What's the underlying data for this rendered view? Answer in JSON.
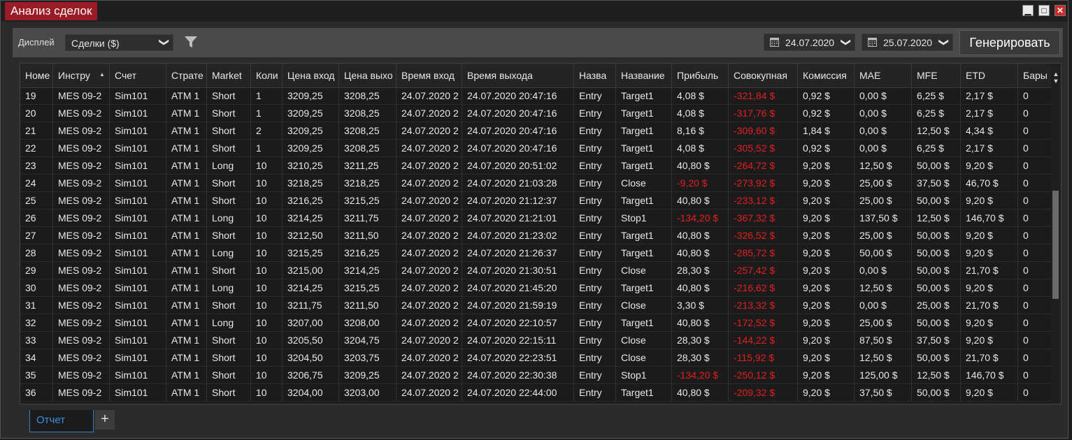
{
  "window": {
    "title": "Анализ сделок",
    "min_glyph": "▁",
    "max_glyph": "□",
    "close_glyph": "✕"
  },
  "toolbar": {
    "display_label": "Дисплей",
    "display_value": "Сделки ($)",
    "from_date": "24.07.2020",
    "to_date": "25.07.2020",
    "generate_label": "Генерировать",
    "chevron": "❯"
  },
  "colors": {
    "negative": "#e02020",
    "accent": "#9b1b26",
    "tab_active": "#3b8fe0"
  },
  "table": {
    "columns": [
      "Номе",
      "Инстру",
      "Счет",
      "Страте",
      "Market",
      "Коли",
      "Цена вход",
      "Цена выхо",
      "Время вход",
      "Время выхода",
      "Назва",
      "Название",
      "Прибыль",
      "Совокупная",
      "Комиссия",
      "MAE",
      "MFE",
      "ETD",
      "Бары"
    ],
    "sort_glyph": "▲",
    "rows": [
      [
        "19",
        "MES 09-2",
        "Sim101",
        "ATM 1",
        "Short",
        "1",
        "3209,25",
        "3208,25",
        "24.07.2020 2",
        "24.07.2020 20:47:16",
        "Entry",
        "Target1",
        "4,08 $",
        "-321,84 $",
        "0,92 $",
        "0,00 $",
        "6,25 $",
        "2,17 $",
        "0"
      ],
      [
        "20",
        "MES 09-2",
        "Sim101",
        "ATM 1",
        "Short",
        "1",
        "3209,25",
        "3208,25",
        "24.07.2020 2",
        "24.07.2020 20:47:16",
        "Entry",
        "Target1",
        "4,08 $",
        "-317,76 $",
        "0,92 $",
        "0,00 $",
        "6,25 $",
        "2,17 $",
        "0"
      ],
      [
        "21",
        "MES 09-2",
        "Sim101",
        "ATM 1",
        "Short",
        "2",
        "3209,25",
        "3208,25",
        "24.07.2020 2",
        "24.07.2020 20:47:16",
        "Entry",
        "Target1",
        "8,16 $",
        "-309,60 $",
        "1,84 $",
        "0,00 $",
        "12,50 $",
        "4,34 $",
        "0"
      ],
      [
        "22",
        "MES 09-2",
        "Sim101",
        "ATM 1",
        "Short",
        "1",
        "3209,25",
        "3208,25",
        "24.07.2020 2",
        "24.07.2020 20:47:16",
        "Entry",
        "Target1",
        "4,08 $",
        "-305,52 $",
        "0,92 $",
        "0,00 $",
        "6,25 $",
        "2,17 $",
        "0"
      ],
      [
        "23",
        "MES 09-2",
        "Sim101",
        "ATM 1",
        "Long",
        "10",
        "3210,25",
        "3211,25",
        "24.07.2020 2",
        "24.07.2020 20:51:02",
        "Entry",
        "Target1",
        "40,80 $",
        "-264,72 $",
        "9,20 $",
        "12,50 $",
        "50,00 $",
        "9,20 $",
        "0"
      ],
      [
        "24",
        "MES 09-2",
        "Sim101",
        "ATM 1",
        "Short",
        "10",
        "3218,25",
        "3218,25",
        "24.07.2020 2",
        "24.07.2020 21:03:28",
        "Entry",
        "Close",
        "-9,20 $",
        "-273,92 $",
        "9,20 $",
        "25,00 $",
        "37,50 $",
        "46,70 $",
        "0"
      ],
      [
        "25",
        "MES 09-2",
        "Sim101",
        "ATM 1",
        "Short",
        "10",
        "3216,25",
        "3215,25",
        "24.07.2020 2",
        "24.07.2020 21:12:37",
        "Entry",
        "Target1",
        "40,80 $",
        "-233,12 $",
        "9,20 $",
        "25,00 $",
        "50,00 $",
        "9,20 $",
        "0"
      ],
      [
        "26",
        "MES 09-2",
        "Sim101",
        "ATM 1",
        "Long",
        "10",
        "3214,25",
        "3211,75",
        "24.07.2020 2",
        "24.07.2020 21:21:01",
        "Entry",
        "Stop1",
        "-134,20 $",
        "-367,32 $",
        "9,20 $",
        "137,50 $",
        "12,50 $",
        "146,70 $",
        "0"
      ],
      [
        "27",
        "MES 09-2",
        "Sim101",
        "ATM 1",
        "Short",
        "10",
        "3212,50",
        "3211,50",
        "24.07.2020 2",
        "24.07.2020 21:23:02",
        "Entry",
        "Target1",
        "40,80 $",
        "-326,52 $",
        "9,20 $",
        "25,00 $",
        "50,00 $",
        "9,20 $",
        "0"
      ],
      [
        "28",
        "MES 09-2",
        "Sim101",
        "ATM 1",
        "Long",
        "10",
        "3215,25",
        "3216,25",
        "24.07.2020 2",
        "24.07.2020 21:26:37",
        "Entry",
        "Target1",
        "40,80 $",
        "-285,72 $",
        "9,20 $",
        "50,00 $",
        "50,00 $",
        "9,20 $",
        "0"
      ],
      [
        "29",
        "MES 09-2",
        "Sim101",
        "ATM 1",
        "Short",
        "10",
        "3215,00",
        "3214,25",
        "24.07.2020 2",
        "24.07.2020 21:30:51",
        "Entry",
        "Close",
        "28,30 $",
        "-257,42 $",
        "9,20 $",
        "0,00 $",
        "50,00 $",
        "21,70 $",
        "0"
      ],
      [
        "30",
        "MES 09-2",
        "Sim101",
        "ATM 1",
        "Long",
        "10",
        "3214,25",
        "3215,25",
        "24.07.2020 2",
        "24.07.2020 21:45:20",
        "Entry",
        "Target1",
        "40,80 $",
        "-216,62 $",
        "9,20 $",
        "12,50 $",
        "50,00 $",
        "9,20 $",
        "0"
      ],
      [
        "31",
        "MES 09-2",
        "Sim101",
        "ATM 1",
        "Short",
        "10",
        "3211,75",
        "3211,50",
        "24.07.2020 2",
        "24.07.2020 21:59:19",
        "Entry",
        "Close",
        "3,30 $",
        "-213,32 $",
        "9,20 $",
        "0,00 $",
        "25,00 $",
        "21,70 $",
        "0"
      ],
      [
        "32",
        "MES 09-2",
        "Sim101",
        "ATM 1",
        "Long",
        "10",
        "3207,00",
        "3208,00",
        "24.07.2020 2",
        "24.07.2020 22:10:57",
        "Entry",
        "Target1",
        "40,80 $",
        "-172,52 $",
        "9,20 $",
        "25,00 $",
        "50,00 $",
        "9,20 $",
        "0"
      ],
      [
        "33",
        "MES 09-2",
        "Sim101",
        "ATM 1",
        "Short",
        "10",
        "3205,50",
        "3204,75",
        "24.07.2020 2",
        "24.07.2020 22:15:11",
        "Entry",
        "Close",
        "28,30 $",
        "-144,22 $",
        "9,20 $",
        "87,50 $",
        "37,50 $",
        "9,20 $",
        "0"
      ],
      [
        "34",
        "MES 09-2",
        "Sim101",
        "ATM 1",
        "Short",
        "10",
        "3204,50",
        "3203,75",
        "24.07.2020 2",
        "24.07.2020 22:23:51",
        "Entry",
        "Close",
        "28,30 $",
        "-115,92 $",
        "9,20 $",
        "12,50 $",
        "50,00 $",
        "21,70 $",
        "0"
      ],
      [
        "35",
        "MES 09-2",
        "Sim101",
        "ATM 1",
        "Short",
        "10",
        "3206,75",
        "3209,25",
        "24.07.2020 2",
        "24.07.2020 22:30:38",
        "Entry",
        "Stop1",
        "-134,20 $",
        "-250,12 $",
        "9,20 $",
        "125,00 $",
        "12,50 $",
        "146,70 $",
        "0"
      ],
      [
        "36",
        "MES 09-2",
        "Sim101",
        "ATM 1",
        "Short",
        "10",
        "3204,00",
        "3203,00",
        "24.07.2020 2",
        "24.07.2020 22:44:00",
        "Entry",
        "Target1",
        "40,80 $",
        "-209,32 $",
        "9,20 $",
        "37,50 $",
        "50,00 $",
        "9,20 $",
        "0"
      ]
    ]
  },
  "tabs": {
    "active_label": "Отчет",
    "add_glyph": "+"
  }
}
